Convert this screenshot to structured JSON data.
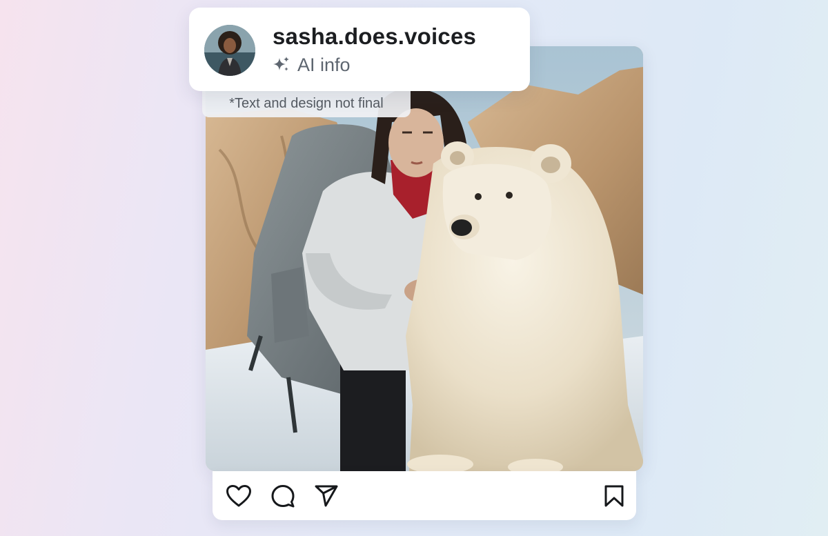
{
  "post": {
    "username": "sasha.does.voices",
    "ai_label": "AI info",
    "ai_icon": "sparkle-icon",
    "disclaimer": "*Text and design not final"
  },
  "actions": [
    {
      "name": "like",
      "icon": "heart-icon"
    },
    {
      "name": "comment",
      "icon": "comment-bubble-icon"
    },
    {
      "name": "share",
      "icon": "paper-plane-icon"
    },
    {
      "name": "save",
      "icon": "bookmark-icon"
    }
  ],
  "colors": {
    "icon_stroke": "#16181b",
    "username_text": "#1c1e21",
    "secondary_text": "#5e6670"
  }
}
